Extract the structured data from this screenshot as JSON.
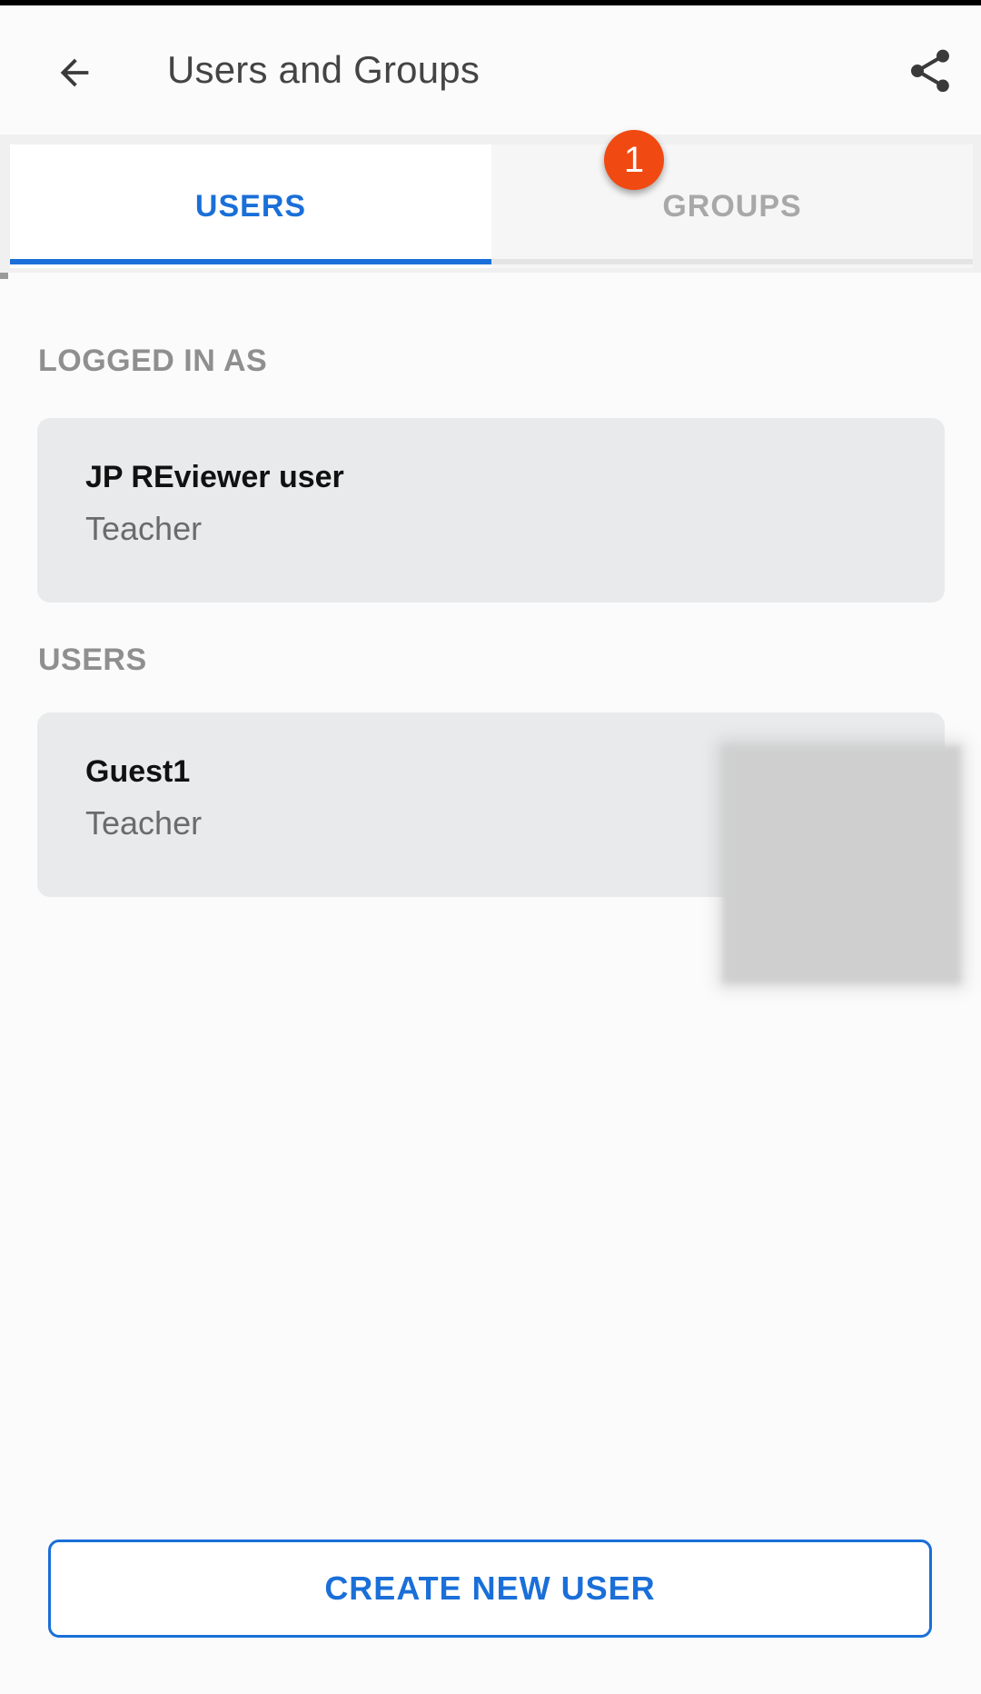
{
  "app_bar": {
    "title": "Users and Groups",
    "back_icon": "arrow-back-icon",
    "share_icon": "share-icon"
  },
  "tabs": [
    {
      "label": "USERS",
      "selected": true
    },
    {
      "label": "GROUPS",
      "selected": false
    }
  ],
  "badge": {
    "count": "1"
  },
  "logged_in": {
    "section_label": "LOGGED IN AS",
    "name": "JP REviewer user",
    "role": "Teacher"
  },
  "users": {
    "section_label": "USERS",
    "items": [
      {
        "name": "Guest1",
        "role": "Teacher"
      }
    ]
  },
  "footer": {
    "create_label": "CREATE NEW USER"
  },
  "colors": {
    "accent": "#1a6fd8",
    "badge": "#f04a12",
    "card_bg": "#e8eaec",
    "section_label": "#8f8f8f"
  }
}
